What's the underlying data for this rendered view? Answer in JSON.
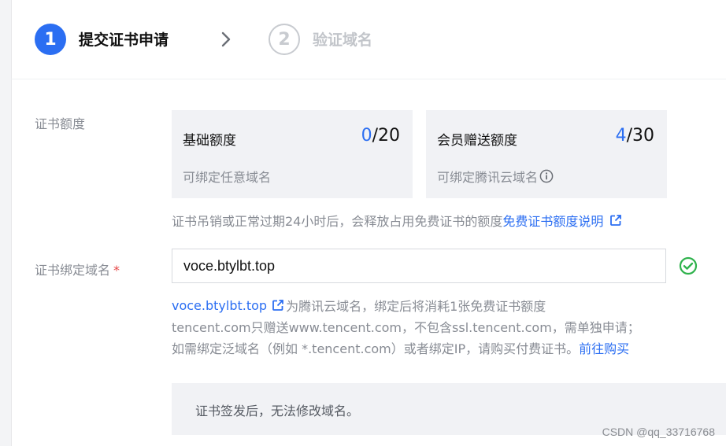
{
  "steps": [
    {
      "number": "1",
      "label": "提交证书申请"
    },
    {
      "number": "2",
      "label": "验证域名"
    }
  ],
  "quota": {
    "label": "证书额度",
    "basic": {
      "title": "基础额度",
      "used": "0",
      "total": "/20",
      "desc": "可绑定任意域名"
    },
    "member": {
      "title": "会员赠送额度",
      "used": "4",
      "total": "/30",
      "desc": "可绑定腾讯云域名"
    },
    "note": "证书吊销或正常过期24小时后，会释放占用免费证书的额度",
    "note_link": "免费证书额度说明"
  },
  "domain": {
    "label": "证书绑定域名",
    "required_mark": "*",
    "value": "voce.btylbt.top",
    "helper_link": "voce.btylbt.top",
    "helper_line1": "为腾讯云域名，绑定后将消耗1张免费证书额度",
    "helper_line2": "tencent.com只赠送www.tencent.com，不包含ssl.tencent.com，需单独申请；",
    "helper_line3": "如需绑定泛域名（例如 *.tencent.com）或者绑定IP，请购买付费证书。",
    "helper_line3_link": "前往购买"
  },
  "warning": "证书签发后，无法修改域名。",
  "watermark": "CSDN @qq_33716768",
  "colors": {
    "accent": "#2b6ef2",
    "success": "#2fb24c",
    "required": "#e54545"
  }
}
